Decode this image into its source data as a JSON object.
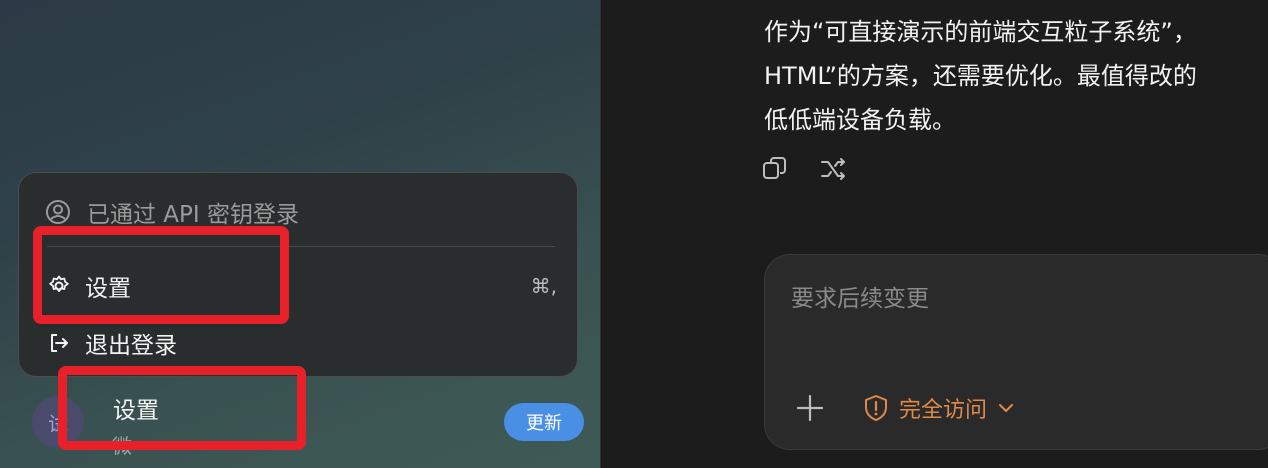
{
  "sidebar": {
    "avatar_initial": "试",
    "under_label": "微",
    "update_label": "更新"
  },
  "menu": {
    "header": "已通过 API 密钥登录",
    "items": [
      {
        "label": "设置",
        "shortcut": "⌘,"
      },
      {
        "label": "退出登录"
      }
    ]
  },
  "annotation": {
    "highlight_label": "设置"
  },
  "chat": {
    "lines": [
      "作为“可直接演示的前端交互粒子系统”，",
      "HTML”的方案，还需要优化。最值得改的",
      "低低端设备负载。"
    ]
  },
  "composer": {
    "placeholder": "要求后续变更",
    "access_label": "完全访问"
  },
  "colors": {
    "highlight": "#e8202a",
    "update_button": "#4a8fe6",
    "access_accent": "#e08a4a"
  }
}
